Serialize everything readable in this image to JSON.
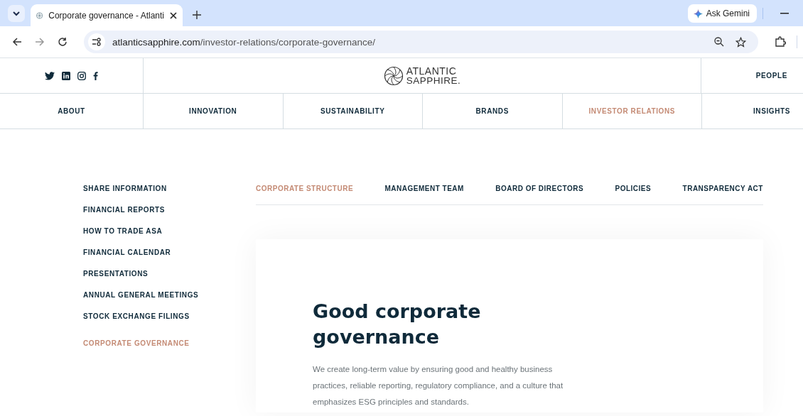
{
  "browser": {
    "tab": {
      "title": "Corporate governance - Atlanti",
      "selected": true
    },
    "gemini": "Ask Gemini",
    "url": "atlanticsapphire.com/investor-relations/corporate-governance/"
  },
  "header": {
    "logo_top": "ATLANTIC",
    "logo_bottom": "SAPPHIRE.",
    "people": "PEOPLE",
    "nav": [
      {
        "label": "ABOUT",
        "selected": false
      },
      {
        "label": "INNOVATION",
        "selected": false
      },
      {
        "label": "SUSTAINABILITY",
        "selected": false
      },
      {
        "label": "BRANDS",
        "selected": false
      },
      {
        "label": "INVESTOR RELATIONS",
        "selected": true
      },
      {
        "label": "INSIGHTS",
        "selected": false
      }
    ]
  },
  "sidebar": [
    {
      "label": "SHARE INFORMATION",
      "selected": false
    },
    {
      "label": "FINANCIAL REPORTS",
      "selected": false
    },
    {
      "label": "HOW TO TRADE ASA",
      "selected": false
    },
    {
      "label": "FINANCIAL CALENDAR",
      "selected": false
    },
    {
      "label": "PRESENTATIONS",
      "selected": false
    },
    {
      "label": "ANNUAL GENERAL MEETINGS",
      "selected": false
    },
    {
      "label": "STOCK EXCHANGE FILINGS",
      "selected": false
    },
    {
      "label": "CORPORATE GOVERNANCE",
      "selected": true
    }
  ],
  "subtabs": [
    {
      "label": "CORPORATE STRUCTURE",
      "selected": true
    },
    {
      "label": "MANAGEMENT TEAM",
      "selected": false
    },
    {
      "label": "BOARD OF DIRECTORS",
      "selected": false
    },
    {
      "label": "POLICIES",
      "selected": false
    },
    {
      "label": "TRANSPARENCY ACT",
      "selected": false
    }
  ],
  "content": {
    "heading": "Good corporate governance",
    "paragraph": "We create long-term value by ensuring good and healthy business practices, reliable reporting, regulatory compliance, and a culture that emphasizes ESG principles and standards."
  }
}
